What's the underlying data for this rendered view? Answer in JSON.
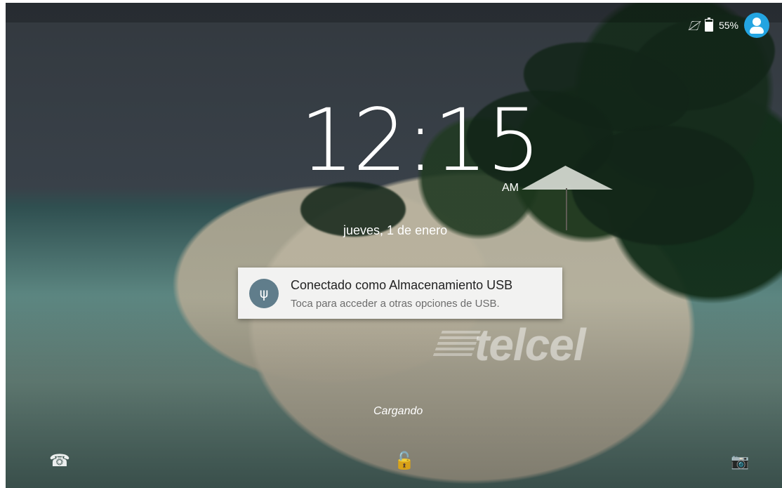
{
  "status_bar": {
    "battery": "55%",
    "icons": [
      "no-signal-icon",
      "battery-charging-icon",
      "account-avatar-icon"
    ]
  },
  "lockscreen": {
    "time": "12:15",
    "ampm": "AM",
    "date": "jueves, 1 de enero"
  },
  "notification": {
    "icon": "usb-icon",
    "title": "Conectado como Almacenamiento USB",
    "text": "Toca para acceder a otras opciones de USB."
  },
  "watermark": {
    "brand": "telcel"
  },
  "footer": {
    "charging": "Cargando",
    "actions": [
      "phone-icon",
      "unlock-icon",
      "camera-icon"
    ]
  },
  "colors": {
    "avatar_blue": "#23a4e1",
    "notification_background": "#f5f5f5",
    "usb_icon_background": "#607d8b"
  }
}
